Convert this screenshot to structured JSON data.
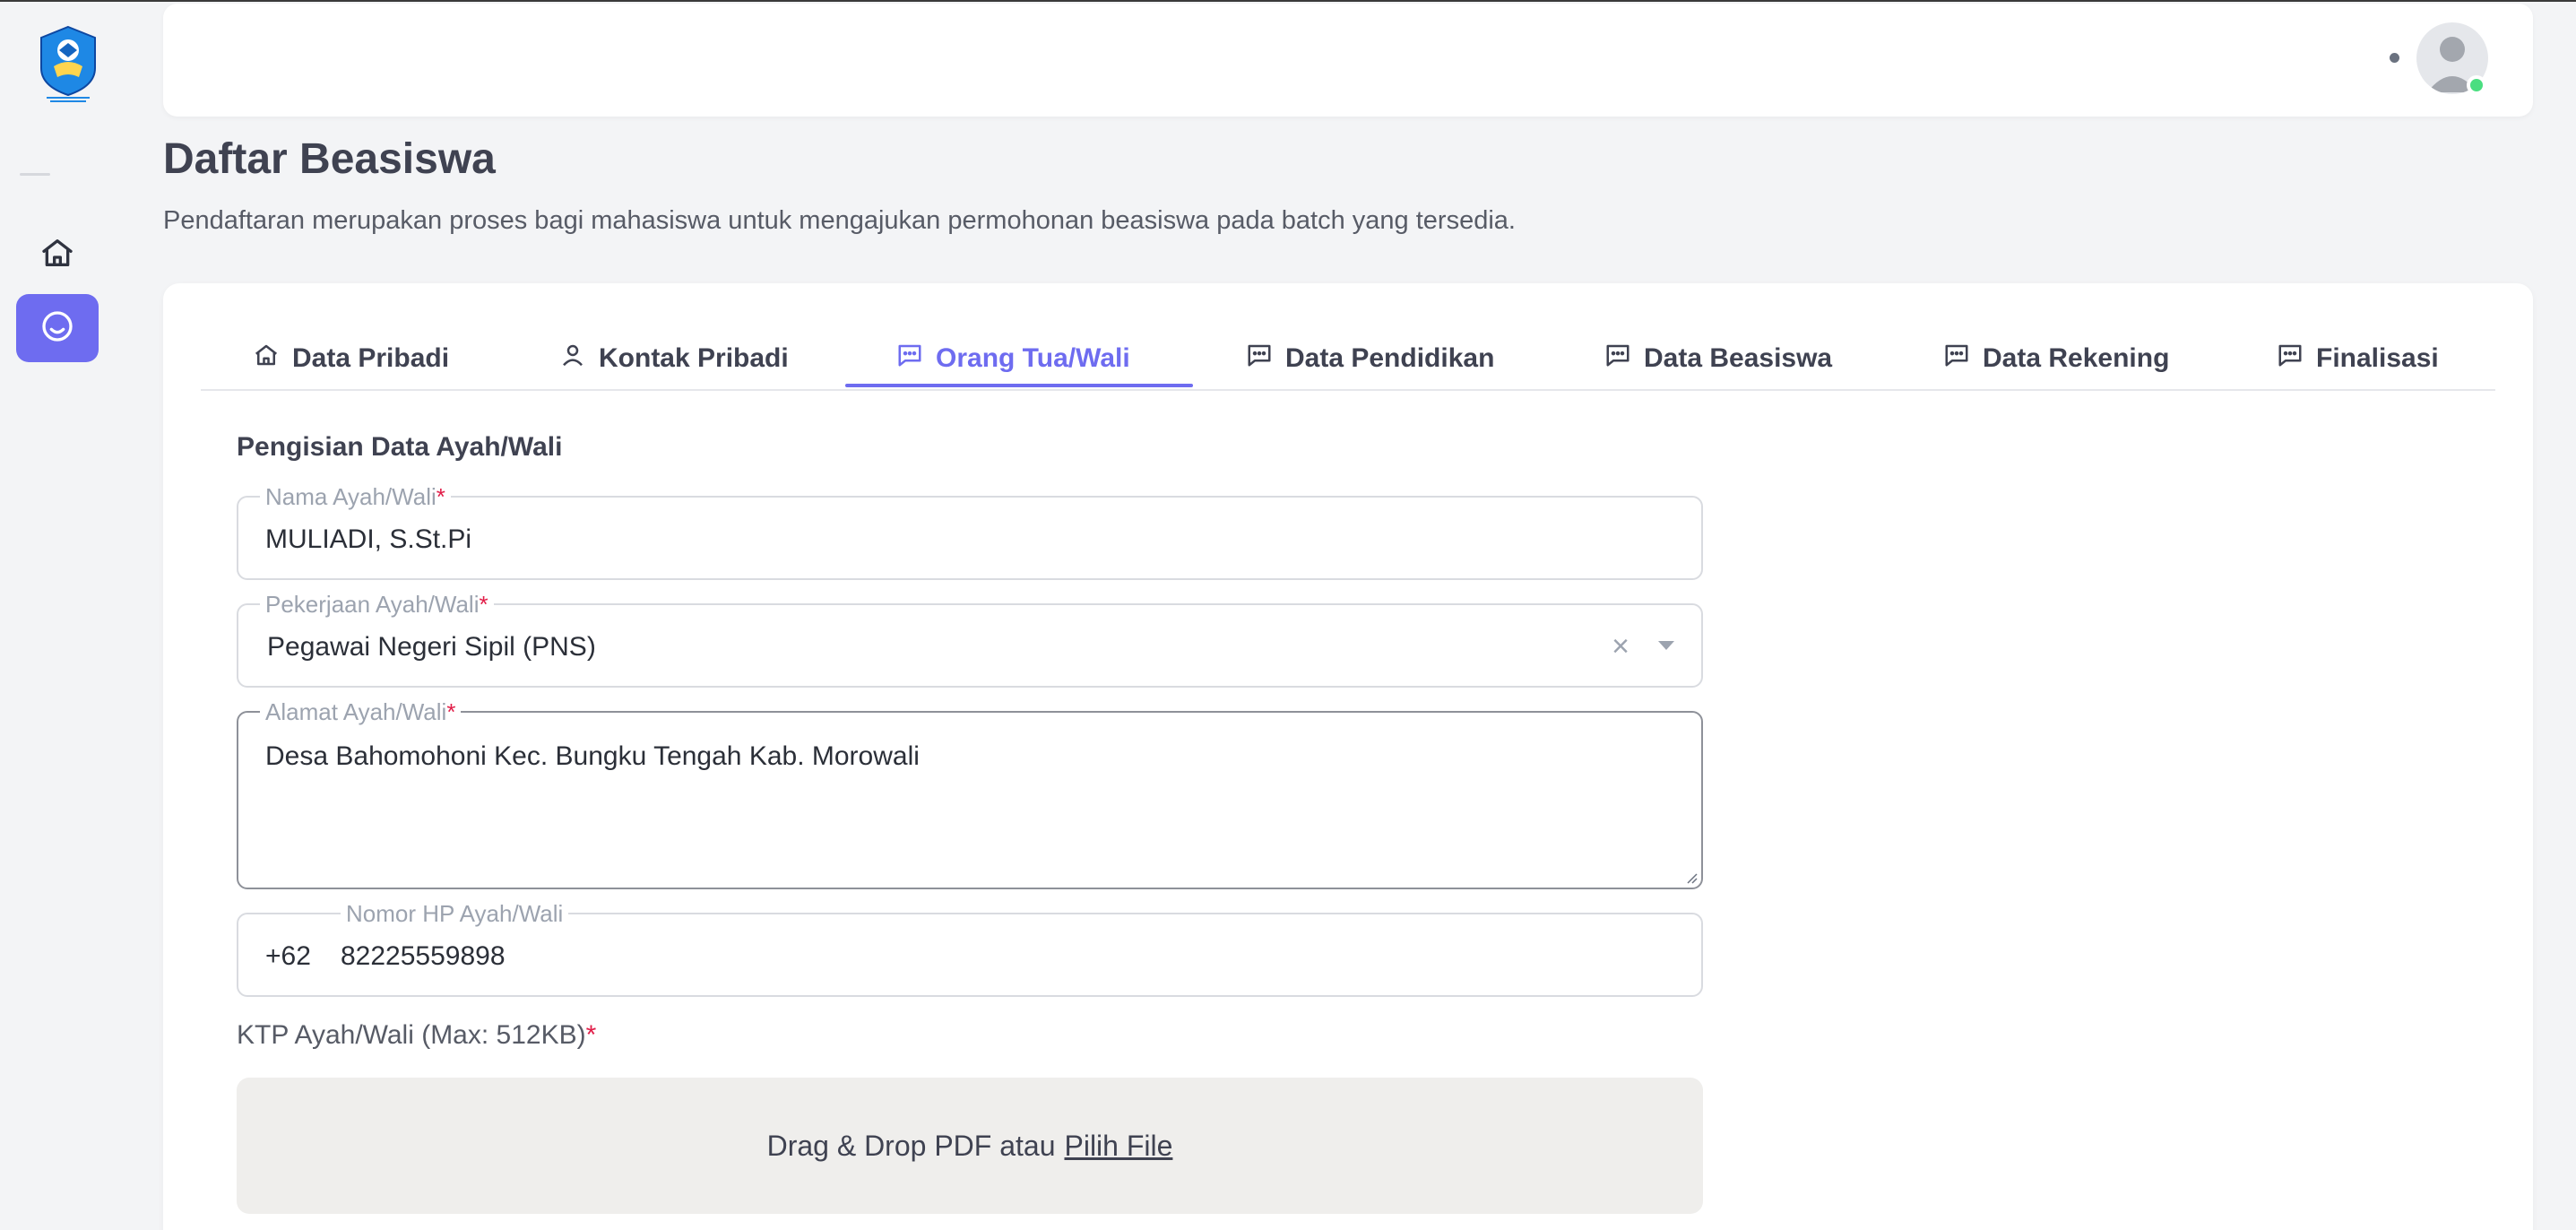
{
  "sidebar": {
    "logo_name": "tut-wuri-handayani-logo",
    "items": [
      {
        "icon": "home-icon"
      },
      {
        "icon": "smile-icon",
        "active": true
      }
    ]
  },
  "header": {
    "avatar_status_color": "#4ade80"
  },
  "page": {
    "title": "Daftar Beasiswa",
    "description": "Pendaftaran merupakan proses bagi mahasiswa untuk mengajukan permohonan beasiswa pada batch yang tersedia."
  },
  "tabs": [
    {
      "label": "Data Pribadi",
      "icon": "home-icon"
    },
    {
      "label": "Kontak Pribadi",
      "icon": "user-icon"
    },
    {
      "label": "Orang Tua/Wali",
      "icon": "chat-icon",
      "active": true
    },
    {
      "label": "Data Pendidikan",
      "icon": "chat-icon"
    },
    {
      "label": "Data Beasiswa",
      "icon": "chat-icon"
    },
    {
      "label": "Data Rekening",
      "icon": "chat-icon"
    },
    {
      "label": "Finalisasi",
      "icon": "chat-icon"
    }
  ],
  "form": {
    "section_title": "Pengisian Data Ayah/Wali",
    "nama": {
      "label": "Nama Ayah/Wali",
      "required_mark": "*",
      "value": "MULIADI, S.St.Pi"
    },
    "pekerjaan": {
      "label": "Pekerjaan Ayah/Wali",
      "required_mark": "*",
      "value": "Pegawai Negeri Sipil (PNS)",
      "clear": "×"
    },
    "alamat": {
      "label": "Alamat Ayah/Wali",
      "required_mark": "*",
      "value": "Desa Bahomohoni Kec. Bungku Tengah Kab. Morowali"
    },
    "hp": {
      "label": "Nomor HP Ayah/Wali",
      "prefix": "+62",
      "value": "82225559898"
    },
    "ktp": {
      "label": "KTP Ayah/Wali (Max: 512KB)",
      "required_mark": "*",
      "drop_text": "Drag & Drop PDF atau",
      "pick_link": "Pilih File"
    }
  },
  "colors": {
    "accent": "#6e6cf0",
    "required": "#e11d48"
  }
}
